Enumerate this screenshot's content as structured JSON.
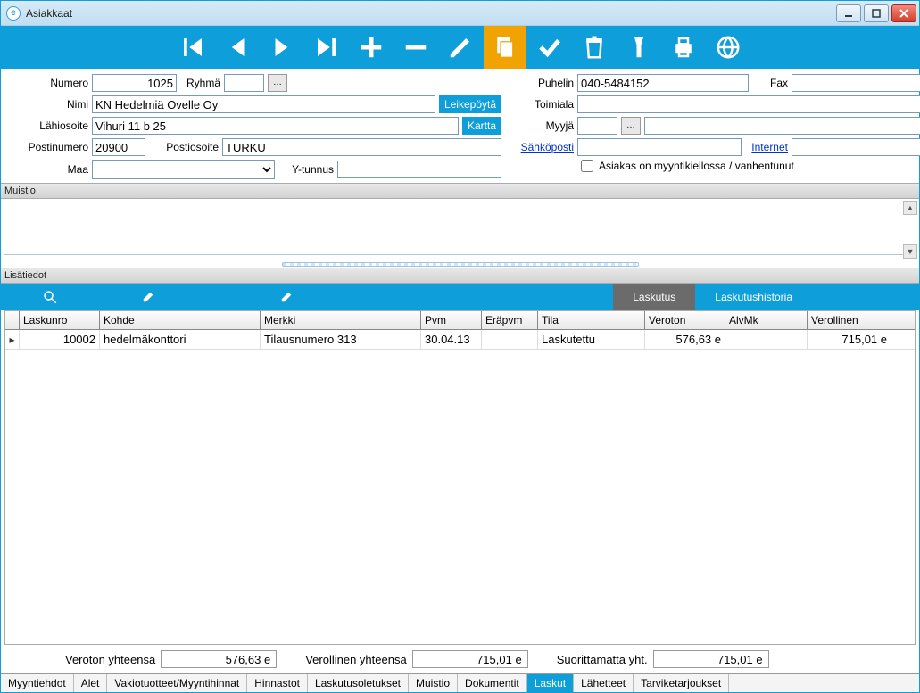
{
  "window": {
    "title": "Asiakkaat",
    "app_icon": "e"
  },
  "winbtns": {
    "min": "minimize-icon",
    "max": "maximize-icon",
    "close": "close-icon"
  },
  "toolbar": {
    "first": "first-icon",
    "prev": "prev-icon",
    "next": "next-icon",
    "last": "last-icon",
    "add": "plus-icon",
    "remove": "minus-icon",
    "edit": "pencil-icon",
    "copy": "copy-icon",
    "confirm": "check-icon",
    "delete": "trash-icon",
    "flashlight": "flashlight-icon",
    "print": "print-icon",
    "globe": "globe-icon"
  },
  "labels": {
    "numero": "Numero",
    "ryhma": "Ryhmä",
    "nimi": "Nimi",
    "lahiosoite": "Lähiosoite",
    "postinumero": "Postinumero",
    "postiosoite": "Postiosoite",
    "maa": "Maa",
    "ytunnus": "Y-tunnus",
    "puhelin": "Puhelin",
    "fax": "Fax",
    "toimiala": "Toimiala",
    "myyja": "Myyjä",
    "sahkoposti": "Sähköposti",
    "internet": "Internet",
    "asiakas_myyntikielto": "Asiakas on myyntikiellossa / vanhentunut",
    "leikepoyta": "Leikepöytä",
    "kartta": "Kartta",
    "muistio": "Muistio",
    "lisatiedot": "Lisätiedot"
  },
  "fields": {
    "numero": "1025",
    "ryhma": "",
    "nimi": "KN Hedelmiä Ovelle Oy",
    "lahiosoite": "Vihuri 11 b 25",
    "postinumero": "20900",
    "postiosoite": "TURKU",
    "maa": "",
    "ytunnus": "",
    "puhelin": "040-5484152",
    "fax": "",
    "toimiala": "",
    "myyja": "",
    "sahkoposti": "",
    "internet": "",
    "myyntikielto": false,
    "muistio": ""
  },
  "detail_tabs": {
    "laskutus": "Laskutus",
    "historia": "Laskutushistoria"
  },
  "grid": {
    "headers": {
      "laskunro": "Laskunro",
      "kohde": "Kohde",
      "merkki": "Merkki",
      "pvm": "Pvm",
      "erapvm": "Eräpvm",
      "tila": "Tila",
      "veroton": "Veroton",
      "alvmk": "AlvMk",
      "verollinen": "Verollinen"
    },
    "rows": [
      {
        "laskunro": "10002",
        "kohde": "hedelmäkonttori",
        "merkki": "Tilausnumero 313",
        "pvm": "30.04.13",
        "erapvm": "",
        "tila": "Laskutettu",
        "veroton": "576,63 e",
        "alvmk": "",
        "verollinen": "715,01 e"
      }
    ]
  },
  "totals": {
    "veroton_lbl": "Veroton yhteensä",
    "veroton_val": "576,63 e",
    "verollinen_lbl": "Verollinen yhteensä",
    "verollinen_val": "715,01 e",
    "suorittamatta_lbl": "Suorittamatta yht.",
    "suorittamatta_val": "715,01 e"
  },
  "bottom_tabs": [
    "Myyntiehdot",
    "Alet",
    "Vakiotuotteet/Myyntihinnat",
    "Hinnastot",
    "Laskutusoletukset",
    "Muistio",
    "Dokumentit",
    "Laskut",
    "Lähetteet",
    "Tarviketarjoukset"
  ],
  "active_bottom_tab": 7
}
